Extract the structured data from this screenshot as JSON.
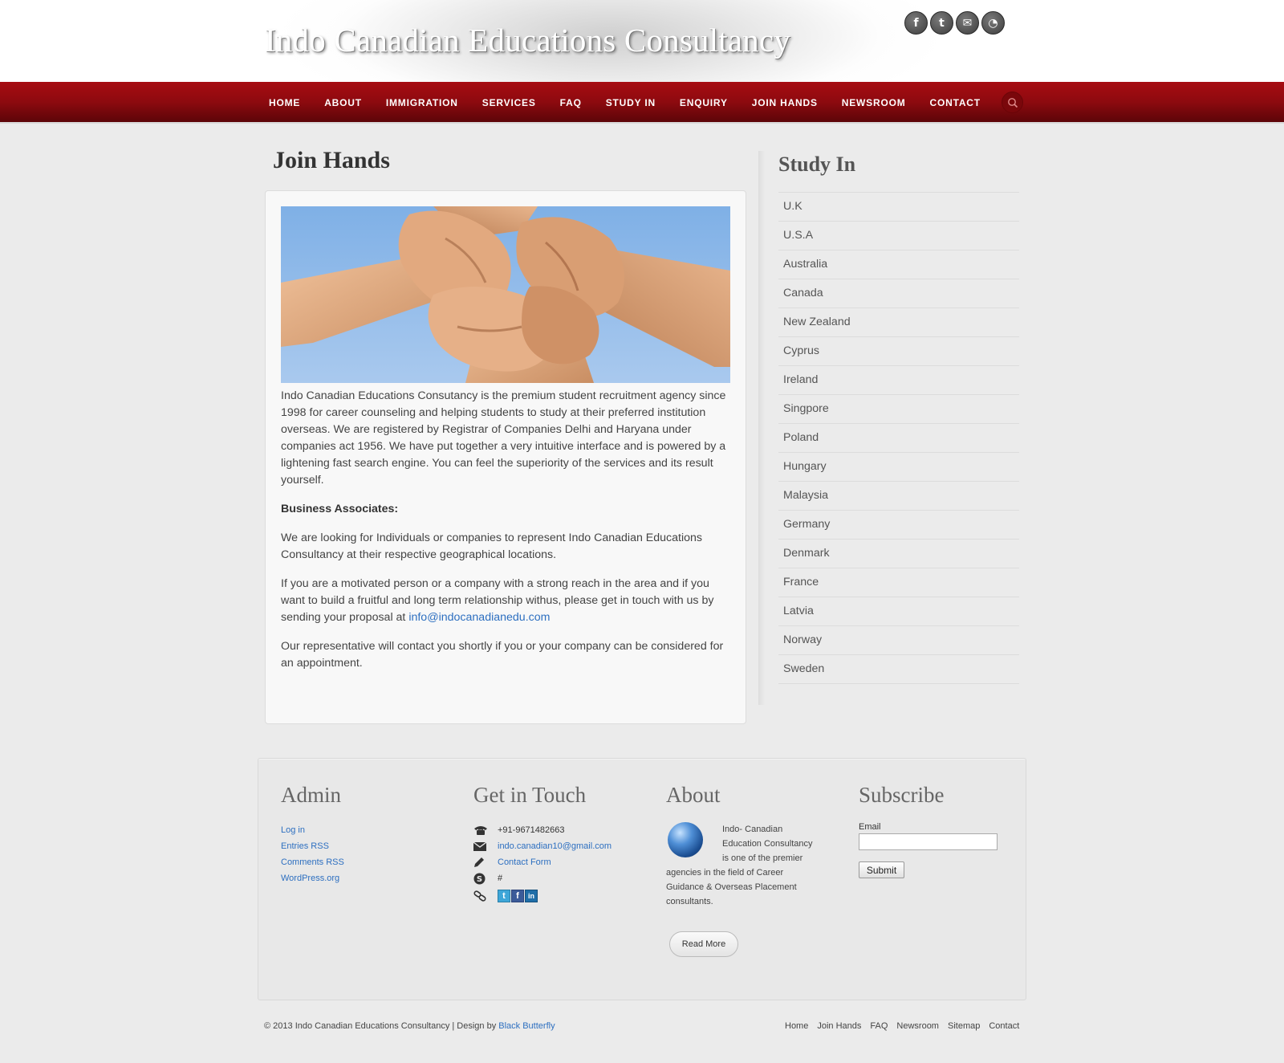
{
  "header": {
    "site_title": "Indo Canadian Educations Consultancy",
    "social": [
      {
        "icon": "facebook-icon",
        "glyph": "f"
      },
      {
        "icon": "twitter-icon",
        "glyph": "t"
      },
      {
        "icon": "mail-icon",
        "glyph": "✉"
      },
      {
        "icon": "rss-icon",
        "glyph": "◔"
      }
    ]
  },
  "nav": {
    "items": [
      "HOME",
      "ABOUT",
      "IMMIGRATION",
      "SERVICES",
      "FAQ",
      "STUDY IN",
      "ENQUIRY",
      "JOIN HANDS",
      "NEWSROOM",
      "CONTACT"
    ],
    "search_icon": "search-icon"
  },
  "content": {
    "title": "Join Hands",
    "paragraph1": "Indo Canadian Educations Consutancy is the premium student recruitment agency since 1998 for career counseling and helping students to study at their preferred institution overseas. We are registered by Registrar of Companies Delhi and Haryana under companies act 1956. We have put together a very intuitive interface and is powered by a lightening fast search engine. You can feel the superiority of the services and its result yourself.",
    "business_heading": "Business Associates:",
    "paragraph2": "We are looking for Individuals or companies to represent Indo Canadian Educations Consultancy at their respective geographical locations.",
    "paragraph3": "If you are a motivated person or a company with a strong reach in the area and if you want to build a fruitful and long term relationship withus, please get in touch with us by sending your proposal at ",
    "email": "info@indocanadianedu.com",
    "paragraph4": "Our representative will contact you shortly if you or your company can be considered for an appointment."
  },
  "sidebar": {
    "title": "Study In",
    "items": [
      "U.K",
      "U.S.A",
      "Australia",
      "Canada",
      "New Zealand",
      "Cyprus",
      "Ireland",
      "Singpore",
      "Poland",
      "Hungary",
      "Malaysia",
      "Germany",
      "Denmark",
      "France",
      "Latvia",
      "Norway",
      "Sweden"
    ]
  },
  "footer": {
    "admin": {
      "title": "Admin",
      "links": [
        "Log in",
        "Entries RSS",
        "Comments RSS",
        "WordPress.org"
      ]
    },
    "touch": {
      "title": "Get in Touch",
      "phone": "+91-9671482663",
      "email": "indo.canadian10@gmail.com",
      "contact_form": "Contact Form",
      "skype": "#"
    },
    "about": {
      "title": "About",
      "text": "Indo- Canadian Education Consultancy is one of the premier agencies in the field of Career Guidance & Overseas Placement consultants.",
      "read_more": "Read More"
    },
    "subscribe": {
      "title": "Subscribe",
      "email_label": "Email",
      "submit": "Submit"
    }
  },
  "bottom": {
    "copyright": "© 2013 Indo Canadian Educations Consultancy | Design by ",
    "designer": "Black Butterfly",
    "links": [
      "Home",
      "Join Hands",
      "FAQ",
      "Newsroom",
      "Sitemap",
      "Contact"
    ]
  }
}
